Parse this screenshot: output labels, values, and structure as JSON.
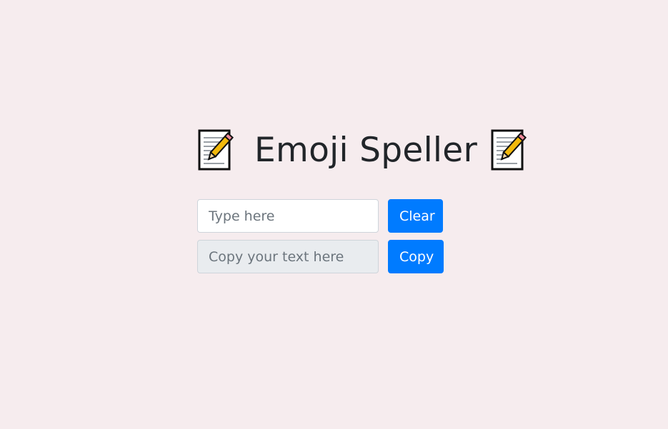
{
  "header": {
    "title": "Emoji Speller",
    "left_icon": "memo-icon",
    "right_icon": "memo-icon"
  },
  "speller": {
    "input_placeholder": "Type here",
    "input_value": "",
    "clear_label": "Clear",
    "output_placeholder": "Copy your text here",
    "output_value": "",
    "copy_label": "Copy"
  },
  "colors": {
    "background": "#f6ecee",
    "button": "#007bff",
    "readonly_field": "#e9ecef"
  }
}
